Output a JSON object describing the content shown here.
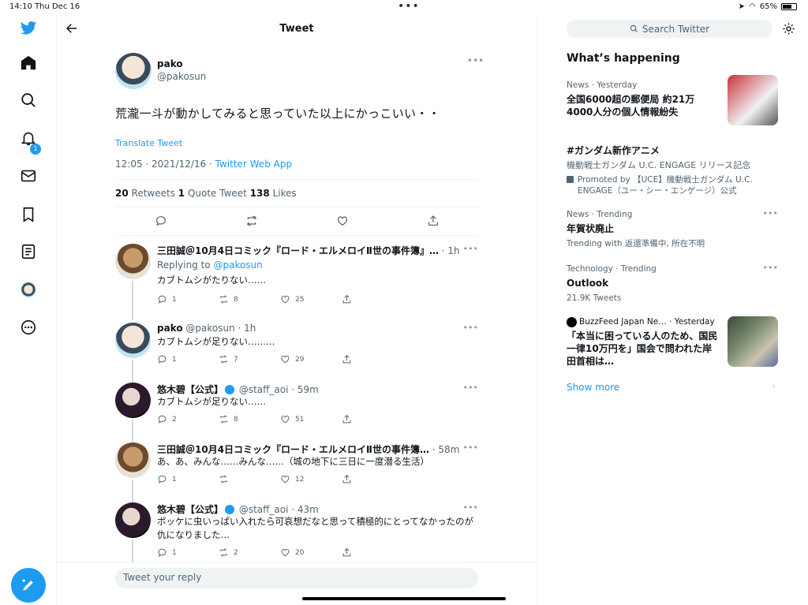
{
  "status": {
    "time": "14:10",
    "date": "Thu Dec 16",
    "battery": "65%"
  },
  "header": {
    "title": "Tweet"
  },
  "tweet": {
    "name": "pako",
    "handle": "@pakosun",
    "text": "荒瀧一斗が動かしてみると思っていた以上にかっこいい・・",
    "translate": "Translate Tweet",
    "timestamp": "12:05 · 2021/12/16 · ",
    "app": "Twitter Web App",
    "retweets": "20",
    "retweets_label": " Retweets ",
    "quotes": "1",
    "quotes_label": " Quote Tweet ",
    "likes": "138",
    "likes_label": " Likes"
  },
  "replies": [
    {
      "name": "三田誠＠10月4日コミック『ロード・エルメロイⅡ世の事件簿』…",
      "handle": "",
      "time": "· 1h",
      "replying_to": "Replying to ",
      "replying_handle": "@pakosun",
      "text": "カブトムシがたりない……",
      "reply": "1",
      "rt": "8",
      "like": "25"
    },
    {
      "name": "pako",
      "handle": " @pakosun",
      "time": "· 1h",
      "text": "カブトムシが足りない………",
      "reply": "1",
      "rt": "7",
      "like": "29"
    },
    {
      "name": "悠木碧【公式】",
      "handle": "@staff_aoi",
      "time": "· 59m",
      "text": "カブトムシが足りない……",
      "reply": "2",
      "rt": "8",
      "like": "51"
    },
    {
      "name": "三田誠＠10月4日コミック『ロード・エルメロイⅡ世の事件簿…",
      "handle": "",
      "time": "· 58m",
      "text": "あ、あ、みんな……みんな……（城の地下に三日に一度潜る生活）",
      "reply": "1",
      "rt": "",
      "like": "12"
    },
    {
      "name": "悠木碧【公式】",
      "handle": "@staff_aoi",
      "time": "· 43m",
      "text": "ポッケに虫いっぱい入れたら可哀想だなと思って積極的にとってなかったのが仇になりました…",
      "reply": "1",
      "rt": "2",
      "like": "20"
    }
  ],
  "reply_placeholder": "Tweet your reply",
  "sidebar": {
    "search_placeholder": "Search Twitter",
    "title": "What’s happening",
    "trends": [
      {
        "ctx": "News · Yesterday",
        "title": "全国6000超の郵便局 約21万4000人分の個人情報紛失"
      },
      {
        "title": "#ガンダム新作アニメ",
        "sub": "機動戦士ガンダム U.C. ENGAGE リリース記念",
        "promo": "Promoted by 【UCE】機動戦士ガンダム U.C. ENGAGE（ユー・シー・エンゲージ）公式"
      },
      {
        "ctx": "News · Trending",
        "title": "年賀状廃止",
        "sub": "Trending with 返還準備中, 所在不明"
      },
      {
        "ctx": "Technology · Trending",
        "title": "Outlook",
        "sub": "21.9K Tweets"
      },
      {
        "ctx": "BuzzFeed Japan Ne… · Yesterday",
        "title": "「本当に困っている人のため、国民一律10万円を」国会で問われた岸田首相は…"
      }
    ],
    "show_more": "Show more"
  },
  "colors": {
    "accent": "#1d9bf0"
  },
  "icons": [
    "twitter-logo-icon",
    "home-icon",
    "search-icon",
    "bell-icon",
    "mail-icon",
    "bookmark-icon",
    "list-icon",
    "profile-avatar",
    "more-circle-icon",
    "compose-icon"
  ]
}
